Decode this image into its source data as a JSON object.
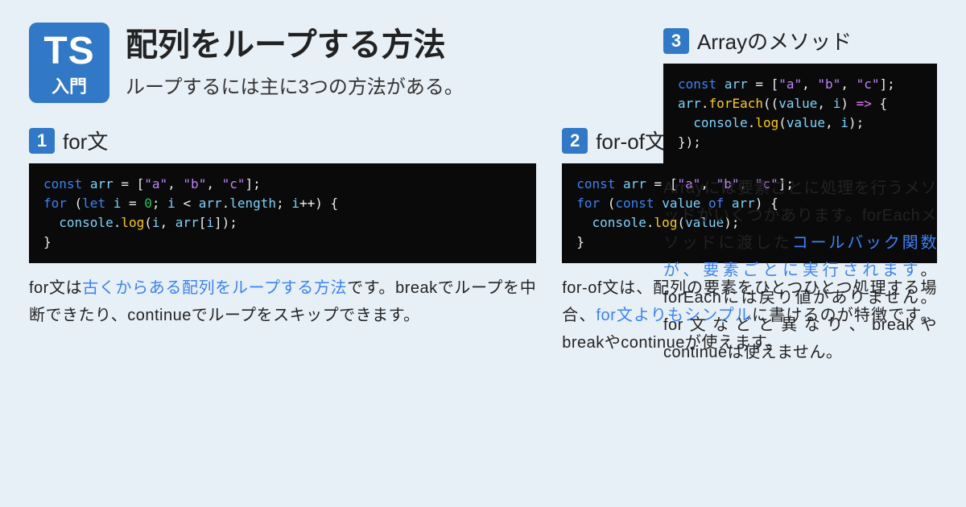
{
  "logo": {
    "main": "TS",
    "sub": "入門"
  },
  "title": "配列をループする方法",
  "subtitle": "ループするには主に3つの方法がある。",
  "sections": [
    {
      "num": "1",
      "title": "for文",
      "desc_pre": "for文は",
      "desc_hl": "古くからある配列をループする方法",
      "desc_post": "です。breakでループを中断できたり、continueでループをスキップできます。"
    },
    {
      "num": "2",
      "title": "for-of文",
      "desc_pre": "for-of文は、配列の要素をひとつひとつ処理する場合、",
      "desc_hl": "for文よりもシンプル",
      "desc_post": "に書けるのが特徴です。breakやcontinueが使えます。"
    },
    {
      "num": "3",
      "title": "Arrayのメソッド",
      "desc_pre": "Arrayには要素ごとに処理を行うメソッドがいくつかあります。forEachメソッドに渡した",
      "desc_hl": "コールバック関数が、要素ごとに実行されます",
      "desc_post": "。forEachには戻り値がありません。for文などと異なり、breakやcontinueは使えません。"
    }
  ],
  "code": {
    "s1": {
      "kw_const": "const",
      "arr": "arr",
      "eq": " = [",
      "a": "\"a\"",
      "c1": ", ",
      "b": "\"b\"",
      "c2": ", ",
      "c": "\"c\"",
      "end": "];",
      "kw_for": "for",
      "open": " (",
      "kw_let": "let",
      "i": "i",
      "eq2": " = ",
      "zero": "0",
      "semi": "; ",
      "i2": "i",
      "lt": " < ",
      "arr2": "arr",
      "dot": ".",
      "len": "length",
      "semi2": "; ",
      "i3": "i",
      "inc": "++",
      "close": ") {",
      "con": "console",
      "dot2": ".",
      "log": "log",
      "p1": "(",
      "i4": "i",
      "cm": ", ",
      "arr3": "arr",
      "br1": "[",
      "i5": "i",
      "br2": "]);",
      "rb": "}"
    },
    "s2": {
      "kw_const": "const",
      "arr": "arr",
      "eq": " = [",
      "a": "\"a\"",
      "c1": ", ",
      "b": "\"b\"",
      "c2": ", ",
      "c": "\"c\"",
      "end": "];",
      "kw_for": "for",
      "open": " (",
      "kw_const2": "const",
      "val": "value",
      "kw_of": "of",
      "arr2": "arr",
      "close": ") {",
      "con": "console",
      "dot": ".",
      "log": "log",
      "p1": "(",
      "val2": "value",
      "p2": ");",
      "rb": "}"
    },
    "s3": {
      "kw_const": "const",
      "arr": "arr",
      "eq": " = [",
      "a": "\"a\"",
      "c1": ", ",
      "b": "\"b\"",
      "c2": ", ",
      "c": "\"c\"",
      "end": "];",
      "arr2": "arr",
      "dot": ".",
      "fe": "forEach",
      "p1": "((",
      "val": "value",
      "cm": ", ",
      "i": "i",
      "p2": ") ",
      "arrow": "=>",
      "ob": " {",
      "con": "console",
      "dot2": ".",
      "log": "log",
      "p3": "(",
      "val2": "value",
      "cm2": ", ",
      "i2": "i",
      "p4": ");",
      "rb": "});"
    }
  }
}
